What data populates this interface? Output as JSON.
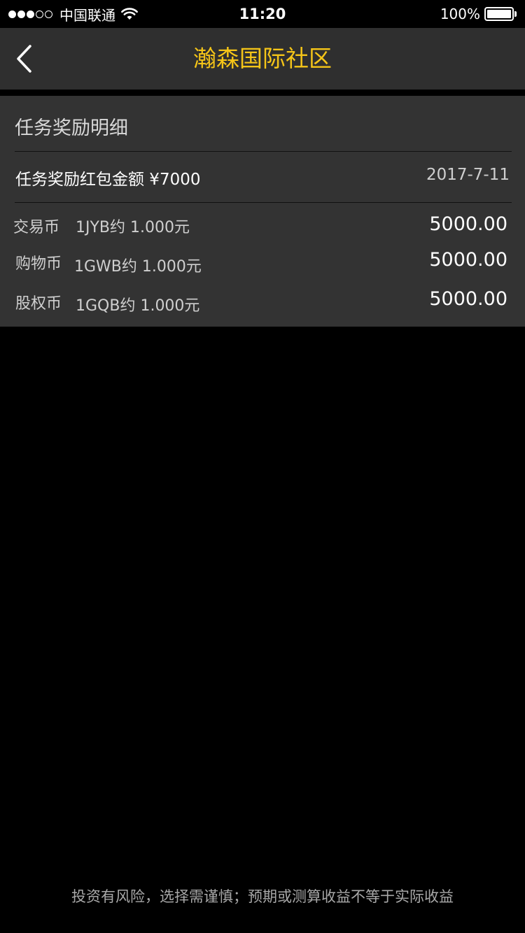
{
  "status_bar": {
    "carrier": "中国联通",
    "time": "11:20",
    "battery": "100%",
    "signal_strength": 3,
    "signal_max": 5,
    "battery_level": 1.0
  },
  "nav": {
    "title": "瀚森国际社区",
    "back_icon": "chevron-left-icon",
    "title_color": "#f5c518"
  },
  "card": {
    "title": "任务奖励明细",
    "reward_label": "任务奖励红包金额 ¥7000",
    "reward_date": "2017-7-11",
    "coins": [
      {
        "name": "交易币",
        "rate": "1JYB约 1.000元",
        "amount": "5000.00"
      },
      {
        "name": "购物币",
        "rate": "1GWB约 1.000元",
        "amount": "5000.00"
      },
      {
        "name": "股权币",
        "rate": "1GQB约 1.000元",
        "amount": "5000.00"
      }
    ]
  },
  "footer": {
    "note": "投资有风险，选择需谨慎；预期或测算收益不等于实际收益"
  }
}
